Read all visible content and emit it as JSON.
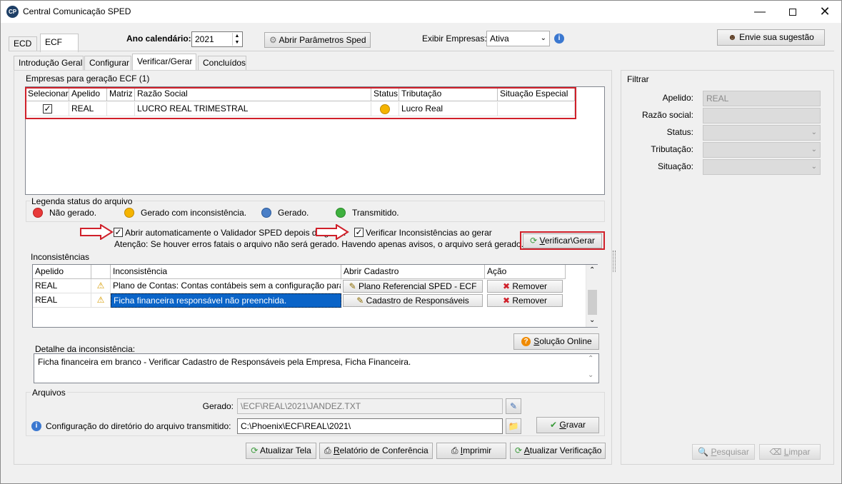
{
  "window": {
    "title": "Central Comunicação SPED",
    "app_icon": "CP"
  },
  "top": {
    "tabs": [
      "ECD",
      "ECF"
    ],
    "ano_label": "Ano calendário:",
    "ano_value": "2021",
    "abrir_param_btn": "Abrir Parâmetros Sped",
    "exibir_label": "Exibir Empresas:",
    "exibir_value": "Ativa",
    "sugestao_btn": "Envie sua sugestão"
  },
  "subtabs": [
    "Introdução Geral",
    "Configurar",
    "Verificar/Gerar",
    "Concluídos"
  ],
  "empresas": {
    "group_label": "Empresas para geração ECF (1)",
    "columns": [
      "Selecionar",
      "Apelido",
      "Matriz",
      "Razão Social",
      "Status",
      "Tributação",
      "Situação Especial"
    ],
    "rows": [
      {
        "apelido": "REAL",
        "matriz": "",
        "razao": "LUCRO REAL TRIMESTRAL",
        "tributacao": "Lucro Real",
        "situacao": ""
      }
    ]
  },
  "legenda": {
    "label": "Legenda status do arquivo",
    "items": [
      {
        "text": "Não gerado.",
        "color": "#e83a3a"
      },
      {
        "text": "Gerado com inconsistência.",
        "color": "#f5b400"
      },
      {
        "text": "Gerado.",
        "color": "#4a7fc7"
      },
      {
        "text": "Transmitido.",
        "color": "#3fb13f"
      }
    ]
  },
  "options": {
    "abrir_validador": "Abrir automaticamente o Validador SPED depois de gerar.",
    "verificar_inconsist": "Verificar Inconsistências ao gerar",
    "atencao": "Atenção: Se houver erros fatais o arquivo não será gerado. Havendo apenas avisos, o arquivo será gerado.",
    "verificar_gerar_btn_pre": "",
    "verificar_gerar_btn_ul": "V",
    "verificar_gerar_btn_post": "erificar\\Gerar"
  },
  "inconsistencias": {
    "group_label": "Inconsistências",
    "columns": [
      "Apelido",
      "",
      "Inconsistência",
      "Abrir Cadastro",
      "Ação"
    ],
    "rows": [
      {
        "apelido": "REAL",
        "texto": "Plano de Contas: Contas contábeis sem a configuração para o",
        "cadastro": "Plano Referencial SPED - ECF",
        "acao": "Remover"
      },
      {
        "apelido": "REAL",
        "texto": "Ficha financeira responsável não preenchida.",
        "cadastro": "Cadastro de Responsáveis",
        "acao": "Remover"
      }
    ],
    "solucao_btn_ul": "S",
    "solucao_btn_post": "olução Online",
    "detalhe_label": "Detalhe da inconsistência:",
    "detalhe_text": "Ficha financeira em branco - Verificar Cadastro de Responsáveis pela Empresa, Ficha Financeira."
  },
  "arquivos": {
    "group_label": "Arquivos",
    "gerado_label": "Gerado:",
    "gerado_value": "\\ECF\\REAL\\2021\\JANDEZ.TXT",
    "config_label": "Configuração do diretório do arquivo transmitido:",
    "config_value": "C:\\Phoenix\\ECF\\REAL\\2021\\",
    "gravar_ul": "G",
    "gravar_post": "ravar"
  },
  "bottom_buttons": {
    "atualizar_tela": "Atualizar Tela",
    "relatorio_ul": "R",
    "relatorio_post": "elatório de Conferência",
    "imprimir_ul": "I",
    "imprimir_post": "mprimir",
    "atualizar_verif_ul": "A",
    "atualizar_verif_post": "tualizar Verificação"
  },
  "filtrar": {
    "label": "Filtrar",
    "apelido_label": "Apelido:",
    "apelido_value": "REAL",
    "razao_label": "Razão social:",
    "status_label": "Status:",
    "tributacao_label": "Tributação:",
    "situacao_label": "Situação:",
    "pesquisar_ul": "P",
    "pesquisar_post": "esquisar",
    "limpar_ul": "L",
    "limpar_post": "impar"
  }
}
